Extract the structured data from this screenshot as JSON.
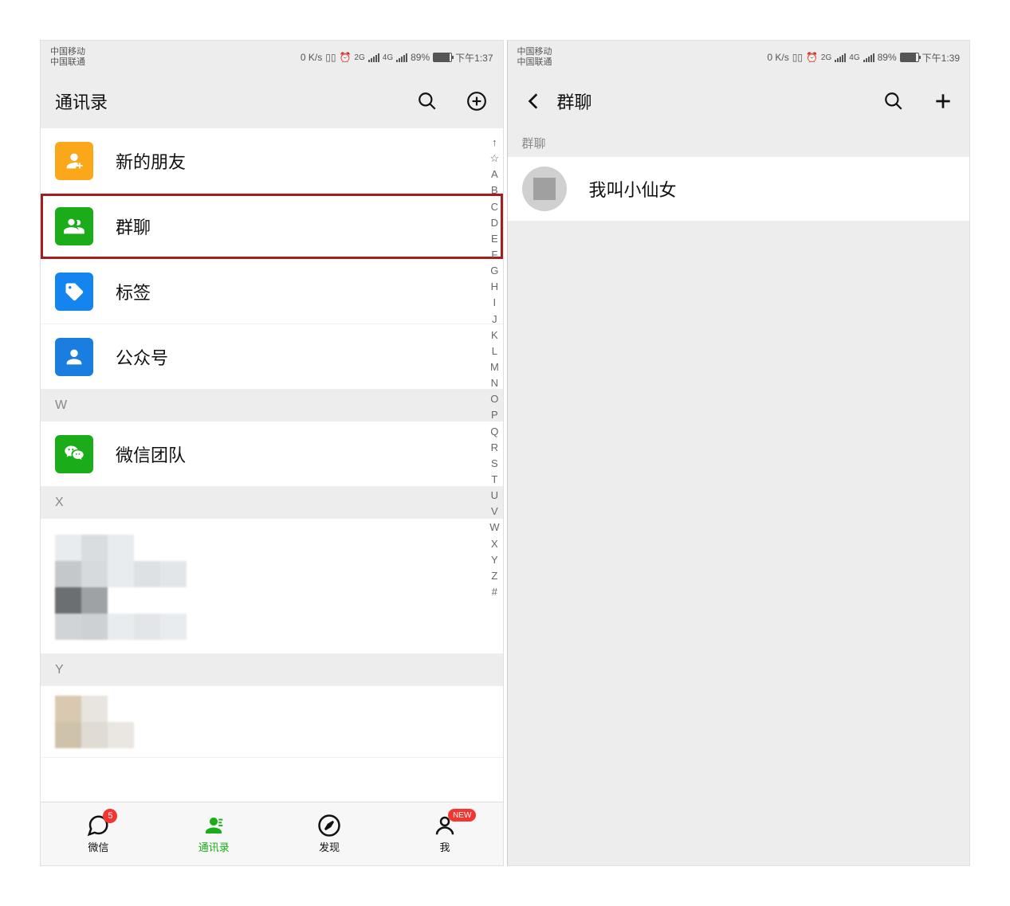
{
  "left": {
    "status": {
      "carrier1": "中国移动",
      "carrier2": "中国联通",
      "speed": "0 K/s",
      "net1": "2G",
      "net2": "4G",
      "battery": "89%",
      "time": "下午1:37"
    },
    "header": {
      "title": "通讯录"
    },
    "menu": {
      "new_friends": "新的朋友",
      "group_chat": "群聊",
      "tags": "标签",
      "official": "公众号"
    },
    "sections": {
      "w": "W",
      "w_item": "微信团队",
      "x": "X",
      "y": "Y"
    },
    "index": [
      "↑",
      "☆",
      "A",
      "B",
      "C",
      "D",
      "E",
      "F",
      "G",
      "H",
      "I",
      "J",
      "K",
      "L",
      "M",
      "N",
      "O",
      "P",
      "Q",
      "R",
      "S",
      "T",
      "U",
      "V",
      "W",
      "X",
      "Y",
      "Z",
      "#"
    ],
    "tabs": {
      "chat": "微信",
      "chat_badge": "5",
      "contacts": "通讯录",
      "discover": "发现",
      "me": "我",
      "me_badge": "NEW"
    }
  },
  "right": {
    "status": {
      "carrier1": "中国移动",
      "carrier2": "中国联通",
      "speed": "0 K/s",
      "net1": "2G",
      "net2": "4G",
      "battery": "89%",
      "time": "下午1:39"
    },
    "header": {
      "title": "群聊"
    },
    "section_label": "群聊",
    "group_name": "我叫小仙女"
  }
}
